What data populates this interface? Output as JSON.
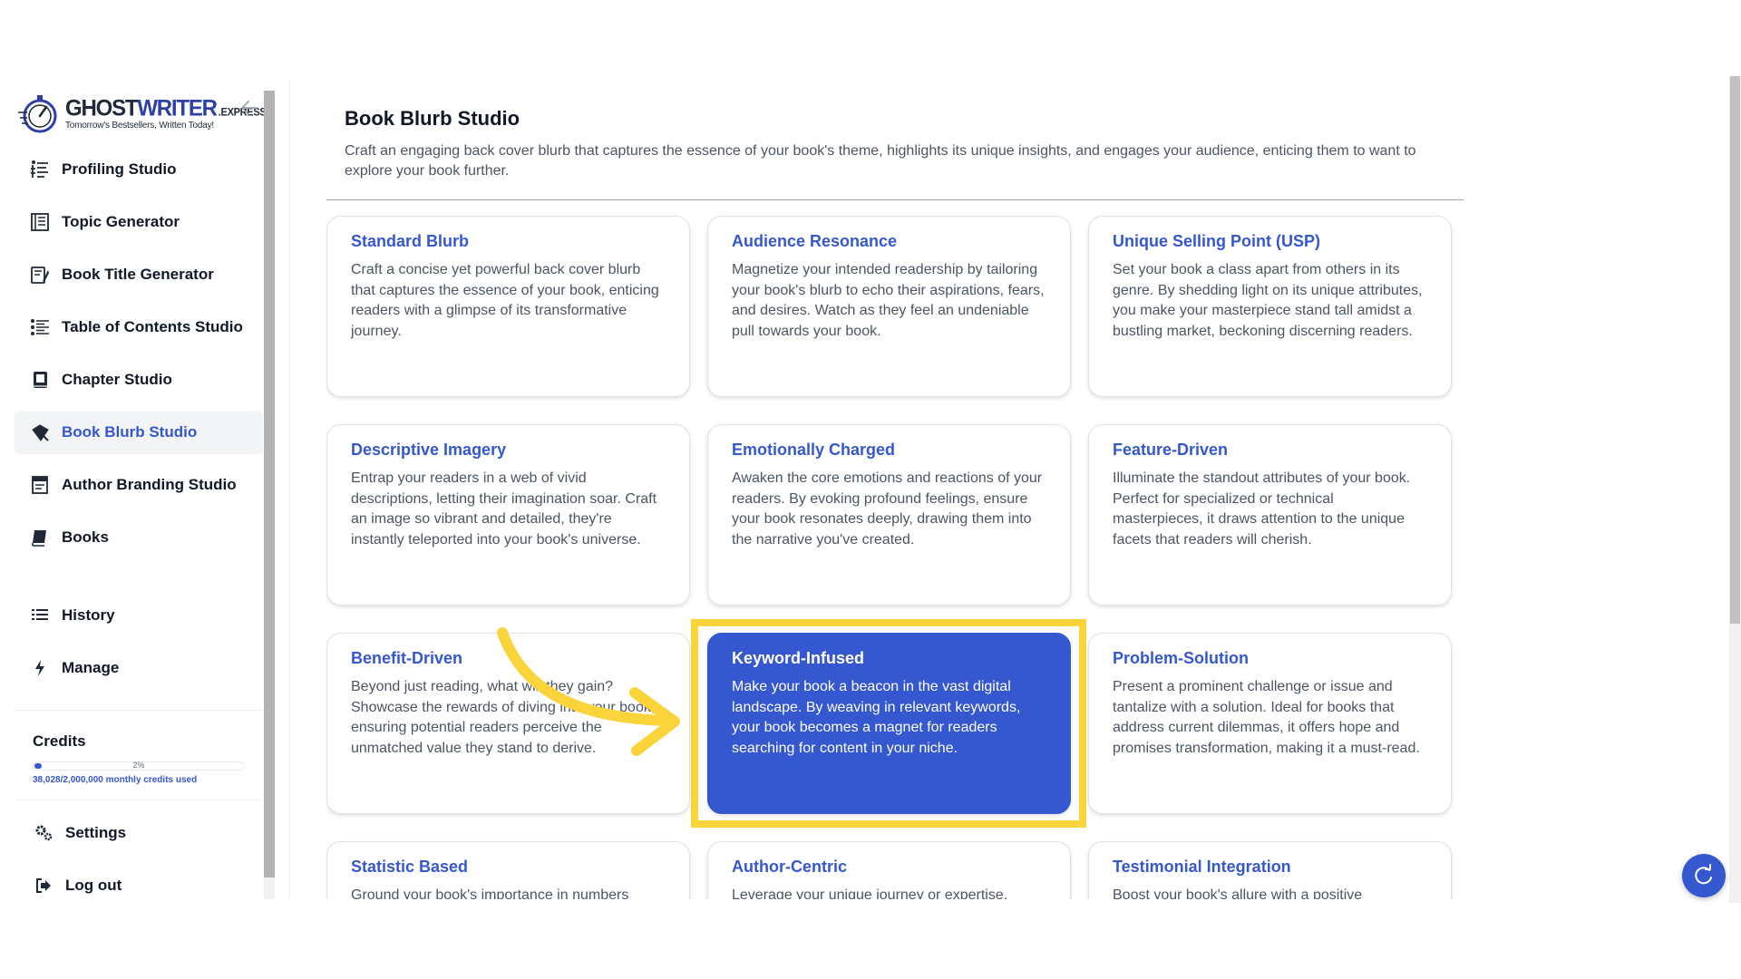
{
  "brand": {
    "name_part1": "GHOST",
    "name_part2": "WRITER",
    "name_suffix": ".EXPRESS",
    "tagline": "Tomorrow's Bestsellers, Written Today!"
  },
  "sidebar": {
    "collapse_icon": "arrow-left-icon",
    "items": [
      {
        "label": "Profiling Studio",
        "icon": "profiling-icon"
      },
      {
        "label": "Topic Generator",
        "icon": "topic-icon"
      },
      {
        "label": "Book Title Generator",
        "icon": "book-title-icon"
      },
      {
        "label": "Table of Contents Studio",
        "icon": "toc-icon"
      },
      {
        "label": "Chapter Studio",
        "icon": "chapter-icon"
      },
      {
        "label": "Book Blurb Studio",
        "icon": "blurb-icon",
        "active": true
      },
      {
        "label": "Author Branding Studio",
        "icon": "author-branding-icon"
      },
      {
        "label": "Books",
        "icon": "books-icon"
      }
    ],
    "secondary": [
      {
        "label": "History",
        "icon": "history-icon"
      },
      {
        "label": "Manage",
        "icon": "lightning-icon"
      }
    ],
    "credits": {
      "title": "Credits",
      "percent_label": "2%",
      "fraction_used": 0.02,
      "used_text": "38,028/2,000,000 monthly credits used"
    },
    "bottom": [
      {
        "label": "Settings",
        "icon": "settings-icon"
      },
      {
        "label": "Log out",
        "icon": "logout-icon"
      }
    ]
  },
  "main": {
    "title": "Book Blurb Studio",
    "description": "Craft an engaging back cover blurb that captures the essence of your book's theme, highlights its unique insights, and engages your audience, enticing them to want to explore your book further.",
    "cards": [
      {
        "title": "Standard Blurb",
        "desc": "Craft a concise yet powerful back cover blurb that captures the essence of your book, enticing readers with a glimpse of its transformative journey."
      },
      {
        "title": "Audience Resonance",
        "desc": "Magnetize your intended readership by tailoring your book's blurb to echo their aspirations, fears, and desires. Watch as they feel an undeniable pull towards your book."
      },
      {
        "title": "Unique Selling Point (USP)",
        "desc": "Set your book a class apart from others in its genre. By shedding light on its unique attributes, you make your masterpiece stand tall amidst a bustling market, beckoning discerning readers."
      },
      {
        "title": "Descriptive Imagery",
        "desc": "Entrap your readers in a web of vivid descriptions, letting their imagination soar. Craft an image so vibrant and detailed, they're instantly teleported into your book's universe."
      },
      {
        "title": "Emotionally Charged",
        "desc": "Awaken the core emotions and reactions of your readers. By evoking profound feelings, ensure your book resonates deeply, drawing them into the narrative you've created."
      },
      {
        "title": "Feature-Driven",
        "desc": "Illuminate the standout attributes of your book. Perfect for specialized or technical masterpieces, it draws attention to the unique facets that readers will cherish."
      },
      {
        "title": "Benefit-Driven",
        "desc": "Beyond just reading, what will they gain? Showcase the rewards of diving into your book, ensuring potential readers perceive the unmatched value they stand to derive."
      },
      {
        "title": "Keyword-Infused",
        "desc": "Make your book a beacon in the vast digital landscape. By weaving in relevant keywords, your book becomes a magnet for readers searching for content in your niche.",
        "selected": true
      },
      {
        "title": "Problem-Solution",
        "desc": "Present a prominent challenge or issue and tantalize with a solution. Ideal for books that address current dilemmas, it offers hope and promises transformation, making it a must-read."
      },
      {
        "title": "Statistic Based",
        "desc": "Ground your book's importance in numbers"
      },
      {
        "title": "Author-Centric",
        "desc": "Leverage your unique journey or expertise."
      },
      {
        "title": "Testimonial Integration",
        "desc": "Boost your book's allure with a positive"
      }
    ]
  },
  "colors": {
    "accent": "#3557cf",
    "highlight": "#fbd33a"
  },
  "fab": {
    "icon": "refresh-icon"
  }
}
